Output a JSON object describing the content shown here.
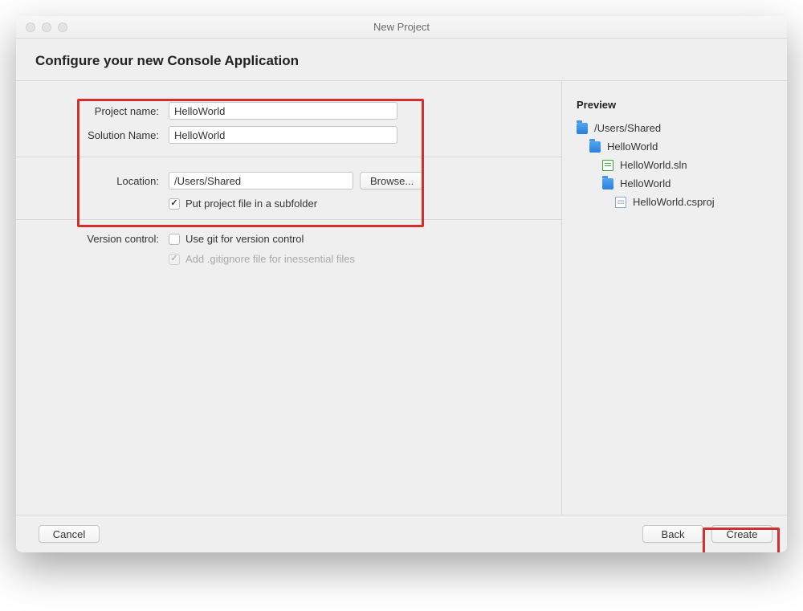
{
  "window": {
    "title": "New Project"
  },
  "header": {
    "title": "Configure your new Console Application"
  },
  "form": {
    "project_name": {
      "label": "Project name:",
      "value": "HelloWorld"
    },
    "solution_name": {
      "label": "Solution Name:",
      "value": "HelloWorld"
    },
    "location": {
      "label": "Location:",
      "value": "/Users/Shared",
      "browse": "Browse..."
    },
    "subfolder": {
      "label": "Put project file in a subfolder",
      "checked": true
    },
    "version_control": {
      "label": "Version control:",
      "git": {
        "label": "Use git for version control",
        "checked": false
      },
      "gitignore": {
        "label": "Add .gitignore file for inessential files",
        "checked": true,
        "disabled": true
      }
    }
  },
  "preview": {
    "title": "Preview",
    "items": [
      {
        "icon": "folder",
        "label": "/Users/Shared",
        "indent": 1
      },
      {
        "icon": "folder",
        "label": "HelloWorld",
        "indent": 2
      },
      {
        "icon": "sln",
        "label": "HelloWorld.sln",
        "indent": 3
      },
      {
        "icon": "folder",
        "label": "HelloWorld",
        "indent": 4
      },
      {
        "icon": "csproj",
        "label": "HelloWorld.csproj",
        "indent": 5
      }
    ]
  },
  "footer": {
    "cancel": "Cancel",
    "back": "Back",
    "create": "Create"
  }
}
